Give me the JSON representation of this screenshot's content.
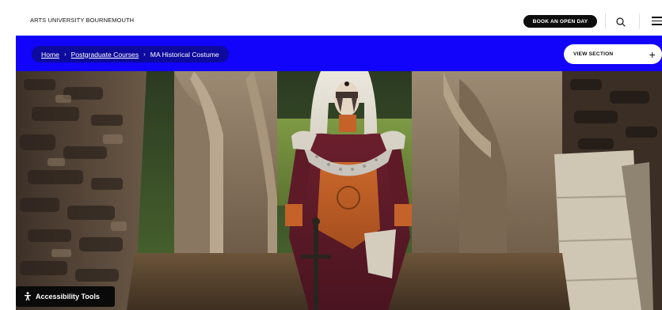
{
  "header": {
    "brand": "ARTS UNIVERSITY BOURNEMOUTH",
    "open_day_label": "BOOK AN OPEN DAY",
    "search_icon": "search-icon",
    "menu_icon": "hamburger-menu-icon"
  },
  "navbar": {
    "background": "#1203fb",
    "breadcrumb": {
      "home": "Home",
      "separator": "›",
      "courses": "Postgraduate Courses",
      "current": "MA Historical Costume"
    },
    "view_section_label": "VIEW SECTION",
    "view_section_icon": "plus-icon"
  },
  "accessibility": {
    "label": "Accessibility Tools",
    "icon": "accessibility-person-icon"
  }
}
